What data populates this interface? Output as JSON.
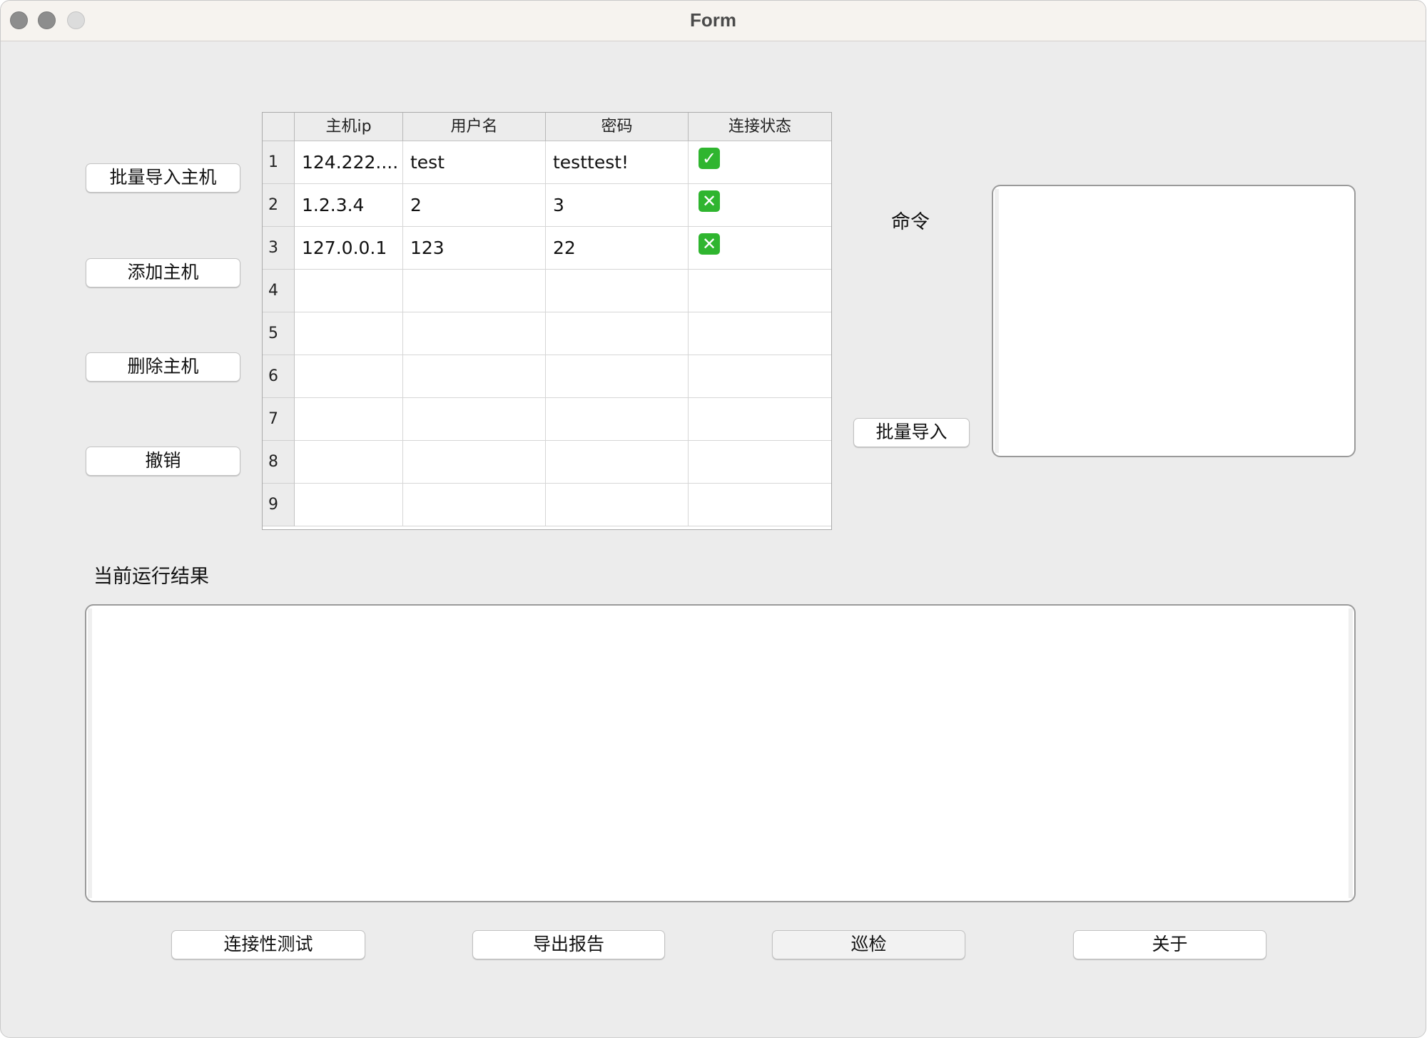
{
  "window": {
    "title": "Form"
  },
  "left_buttons": {
    "batch_import_hosts": "批量导入主机",
    "add_host": "添加主机",
    "delete_host": "删除主机",
    "undo": "撤销"
  },
  "table": {
    "columns": [
      "主机ip",
      "用户名",
      "密码",
      "连接状态"
    ],
    "rows": [
      {
        "num": "1",
        "ip": "124.222....",
        "user": "test",
        "password": "testtest!",
        "status": "connected",
        "status_glyph": "✓"
      },
      {
        "num": "2",
        "ip": "1.2.3.4",
        "user": "2",
        "password": "3",
        "status": "failed",
        "status_glyph": "✕"
      },
      {
        "num": "3",
        "ip": "127.0.0.1",
        "user": "123",
        "password": "22",
        "status": "failed",
        "status_glyph": "✕"
      },
      {
        "num": "4",
        "ip": "",
        "user": "",
        "password": "",
        "status": "",
        "status_glyph": ""
      },
      {
        "num": "5",
        "ip": "",
        "user": "",
        "password": "",
        "status": "",
        "status_glyph": ""
      },
      {
        "num": "6",
        "ip": "",
        "user": "",
        "password": "",
        "status": "",
        "status_glyph": ""
      },
      {
        "num": "7",
        "ip": "",
        "user": "",
        "password": "",
        "status": "",
        "status_glyph": ""
      },
      {
        "num": "8",
        "ip": "",
        "user": "",
        "password": "",
        "status": "",
        "status_glyph": ""
      },
      {
        "num": "9",
        "ip": "",
        "user": "",
        "password": "",
        "status": "",
        "status_glyph": ""
      }
    ]
  },
  "command": {
    "label": "命令",
    "batch_import": "批量导入",
    "value": ""
  },
  "result": {
    "label": "当前运行结果",
    "value": ""
  },
  "bottom_buttons": {
    "connectivity_test": "连接性测试",
    "export_report": "导出报告",
    "inspect": "巡检",
    "about": "关于"
  },
  "colors": {
    "status_ok": "#2fb52f",
    "window_bg": "#ececec"
  }
}
